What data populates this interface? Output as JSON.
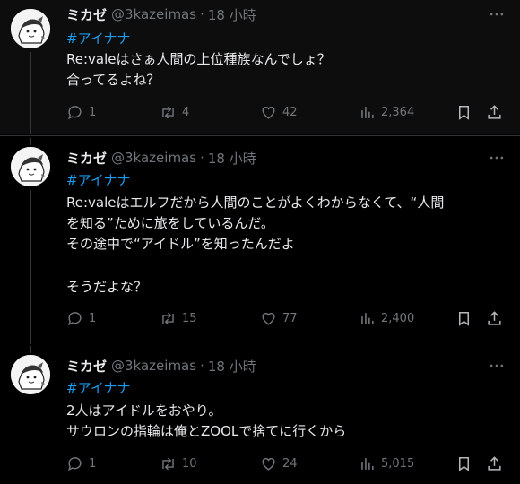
{
  "colors": {
    "background": "#000000",
    "text": "#e7e9ea",
    "muted": "#71767b",
    "link": "#1d9bf0",
    "divider": "#2f3336"
  },
  "tweets": [
    {
      "author_name": "ミカゼ",
      "handle": "@3kazeimas",
      "dot": "·",
      "time": "18 小時",
      "hashtag": "#アイナナ",
      "lines": [
        "Re:valeはさぁ人間の上位種族なんでしょ？",
        "合ってるよね？"
      ],
      "reply_count": "1",
      "retweet_count": "4",
      "like_count": "42",
      "view_count": "2,364"
    },
    {
      "author_name": "ミカゼ",
      "handle": "@3kazeimas",
      "dot": "·",
      "time": "18 小時",
      "hashtag": "#アイナナ",
      "lines": [
        "Re:valeはエルフだから人間のことがよくわからなくて、“人間",
        "を知る”ために旅をしているんだ。",
        "その途中で“アイドル”を知ったんだよ",
        "",
        "そうだよな？"
      ],
      "reply_count": "1",
      "retweet_count": "15",
      "like_count": "77",
      "view_count": "2,400"
    },
    {
      "author_name": "ミカゼ",
      "handle": "@3kazeimas",
      "dot": "·",
      "time": "18 小時",
      "hashtag": "#アイナナ",
      "lines": [
        "2人はアイドルをおやり。",
        "サウロンの指輪は俺とZOOLで捨てに行くから"
      ],
      "reply_count": "1",
      "retweet_count": "10",
      "like_count": "24",
      "view_count": "5,015"
    }
  ],
  "icons": [
    "avatar",
    "more-icon",
    "reply-icon",
    "retweet-icon",
    "like-icon",
    "views-icon",
    "bookmark-icon",
    "share-icon"
  ]
}
